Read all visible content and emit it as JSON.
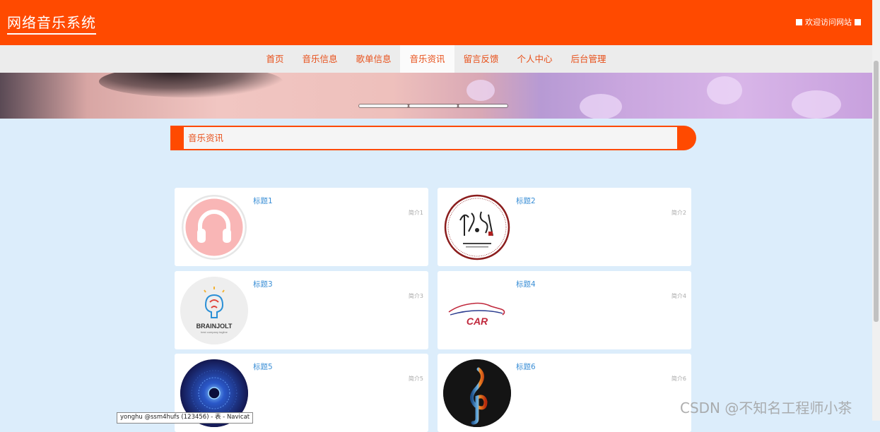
{
  "header": {
    "brand": "网络音乐系统",
    "welcome": "欢迎访问网站"
  },
  "nav": {
    "items": [
      "首页",
      "音乐信息",
      "歌单信息",
      "音乐资讯",
      "留言反馈",
      "个人中心",
      "后台管理"
    ],
    "active_index": 3
  },
  "section": {
    "title": "音乐资讯"
  },
  "cards": [
    {
      "title": "标题1",
      "intro": "简介1",
      "image": "headphones-icon"
    },
    {
      "title": "标题2",
      "intro": "简介2",
      "image": "calligraphy-seal-logo"
    },
    {
      "title": "标题3",
      "intro": "简介3",
      "image": "brainjolt-logo",
      "logo_text": "BRAINJOLT",
      "logo_sub": "best company tagline"
    },
    {
      "title": "标题4",
      "intro": "简介4",
      "image": "car-logo",
      "logo_text": "CAR"
    },
    {
      "title": "标题5",
      "intro": "简介5",
      "image": "sound-wave-image"
    },
    {
      "title": "标题6",
      "intro": "简介6",
      "image": "treble-clef-fire-water-image"
    }
  ],
  "tooltip": "yonghu @ssm4hufs (123456) - 表 - Navicat",
  "watermark": "CSDN @不知名工程师小茶",
  "colors": {
    "primary": "#ff4a00",
    "link": "#3b8fd6",
    "background": "#dcedfb"
  }
}
